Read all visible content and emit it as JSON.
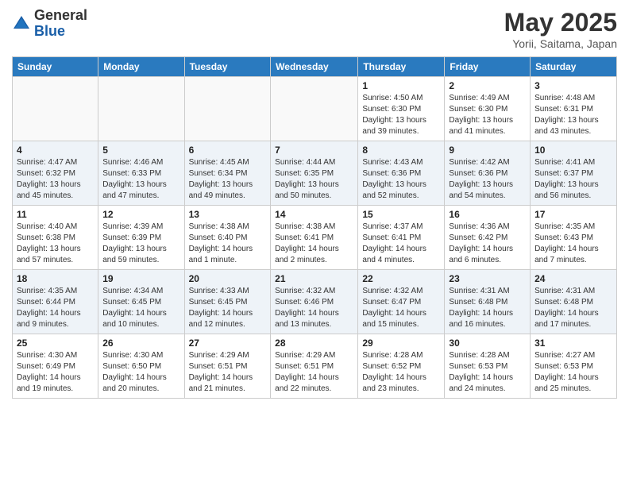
{
  "logo": {
    "general": "General",
    "blue": "Blue"
  },
  "title": "May 2025",
  "location": "Yorii, Saitama, Japan",
  "days_header": [
    "Sunday",
    "Monday",
    "Tuesday",
    "Wednesday",
    "Thursday",
    "Friday",
    "Saturday"
  ],
  "weeks": [
    [
      {
        "num": "",
        "info": ""
      },
      {
        "num": "",
        "info": ""
      },
      {
        "num": "",
        "info": ""
      },
      {
        "num": "",
        "info": ""
      },
      {
        "num": "1",
        "info": "Sunrise: 4:50 AM\nSunset: 6:30 PM\nDaylight: 13 hours\nand 39 minutes."
      },
      {
        "num": "2",
        "info": "Sunrise: 4:49 AM\nSunset: 6:30 PM\nDaylight: 13 hours\nand 41 minutes."
      },
      {
        "num": "3",
        "info": "Sunrise: 4:48 AM\nSunset: 6:31 PM\nDaylight: 13 hours\nand 43 minutes."
      }
    ],
    [
      {
        "num": "4",
        "info": "Sunrise: 4:47 AM\nSunset: 6:32 PM\nDaylight: 13 hours\nand 45 minutes."
      },
      {
        "num": "5",
        "info": "Sunrise: 4:46 AM\nSunset: 6:33 PM\nDaylight: 13 hours\nand 47 minutes."
      },
      {
        "num": "6",
        "info": "Sunrise: 4:45 AM\nSunset: 6:34 PM\nDaylight: 13 hours\nand 49 minutes."
      },
      {
        "num": "7",
        "info": "Sunrise: 4:44 AM\nSunset: 6:35 PM\nDaylight: 13 hours\nand 50 minutes."
      },
      {
        "num": "8",
        "info": "Sunrise: 4:43 AM\nSunset: 6:36 PM\nDaylight: 13 hours\nand 52 minutes."
      },
      {
        "num": "9",
        "info": "Sunrise: 4:42 AM\nSunset: 6:36 PM\nDaylight: 13 hours\nand 54 minutes."
      },
      {
        "num": "10",
        "info": "Sunrise: 4:41 AM\nSunset: 6:37 PM\nDaylight: 13 hours\nand 56 minutes."
      }
    ],
    [
      {
        "num": "11",
        "info": "Sunrise: 4:40 AM\nSunset: 6:38 PM\nDaylight: 13 hours\nand 57 minutes."
      },
      {
        "num": "12",
        "info": "Sunrise: 4:39 AM\nSunset: 6:39 PM\nDaylight: 13 hours\nand 59 minutes."
      },
      {
        "num": "13",
        "info": "Sunrise: 4:38 AM\nSunset: 6:40 PM\nDaylight: 14 hours\nand 1 minute."
      },
      {
        "num": "14",
        "info": "Sunrise: 4:38 AM\nSunset: 6:41 PM\nDaylight: 14 hours\nand 2 minutes."
      },
      {
        "num": "15",
        "info": "Sunrise: 4:37 AM\nSunset: 6:41 PM\nDaylight: 14 hours\nand 4 minutes."
      },
      {
        "num": "16",
        "info": "Sunrise: 4:36 AM\nSunset: 6:42 PM\nDaylight: 14 hours\nand 6 minutes."
      },
      {
        "num": "17",
        "info": "Sunrise: 4:35 AM\nSunset: 6:43 PM\nDaylight: 14 hours\nand 7 minutes."
      }
    ],
    [
      {
        "num": "18",
        "info": "Sunrise: 4:35 AM\nSunset: 6:44 PM\nDaylight: 14 hours\nand 9 minutes."
      },
      {
        "num": "19",
        "info": "Sunrise: 4:34 AM\nSunset: 6:45 PM\nDaylight: 14 hours\nand 10 minutes."
      },
      {
        "num": "20",
        "info": "Sunrise: 4:33 AM\nSunset: 6:45 PM\nDaylight: 14 hours\nand 12 minutes."
      },
      {
        "num": "21",
        "info": "Sunrise: 4:32 AM\nSunset: 6:46 PM\nDaylight: 14 hours\nand 13 minutes."
      },
      {
        "num": "22",
        "info": "Sunrise: 4:32 AM\nSunset: 6:47 PM\nDaylight: 14 hours\nand 15 minutes."
      },
      {
        "num": "23",
        "info": "Sunrise: 4:31 AM\nSunset: 6:48 PM\nDaylight: 14 hours\nand 16 minutes."
      },
      {
        "num": "24",
        "info": "Sunrise: 4:31 AM\nSunset: 6:48 PM\nDaylight: 14 hours\nand 17 minutes."
      }
    ],
    [
      {
        "num": "25",
        "info": "Sunrise: 4:30 AM\nSunset: 6:49 PM\nDaylight: 14 hours\nand 19 minutes."
      },
      {
        "num": "26",
        "info": "Sunrise: 4:30 AM\nSunset: 6:50 PM\nDaylight: 14 hours\nand 20 minutes."
      },
      {
        "num": "27",
        "info": "Sunrise: 4:29 AM\nSunset: 6:51 PM\nDaylight: 14 hours\nand 21 minutes."
      },
      {
        "num": "28",
        "info": "Sunrise: 4:29 AM\nSunset: 6:51 PM\nDaylight: 14 hours\nand 22 minutes."
      },
      {
        "num": "29",
        "info": "Sunrise: 4:28 AM\nSunset: 6:52 PM\nDaylight: 14 hours\nand 23 minutes."
      },
      {
        "num": "30",
        "info": "Sunrise: 4:28 AM\nSunset: 6:53 PM\nDaylight: 14 hours\nand 24 minutes."
      },
      {
        "num": "31",
        "info": "Sunrise: 4:27 AM\nSunset: 6:53 PM\nDaylight: 14 hours\nand 25 minutes."
      }
    ]
  ]
}
